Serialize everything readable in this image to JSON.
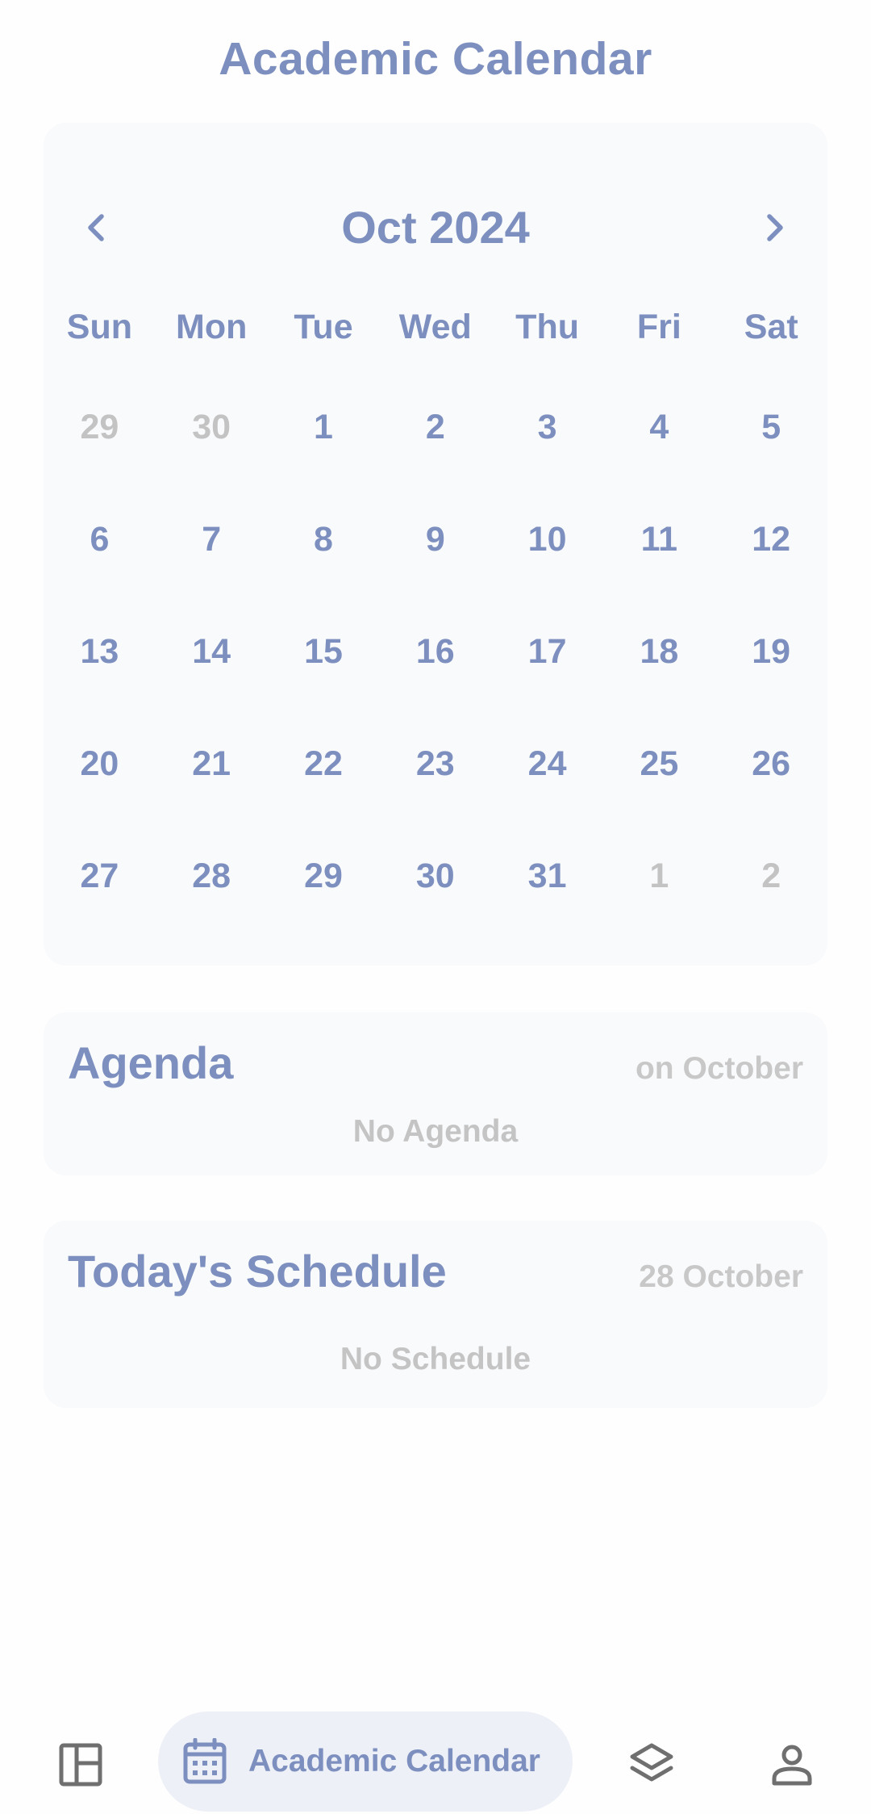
{
  "header": {
    "title": "Academic Calendar"
  },
  "calendar": {
    "month_label": "Oct 2024",
    "prev_icon": "chevron-left-icon",
    "next_icon": "chevron-right-icon",
    "weekdays": [
      "Sun",
      "Mon",
      "Tue",
      "Wed",
      "Thu",
      "Fri",
      "Sat"
    ],
    "days": [
      {
        "label": "29",
        "muted": true
      },
      {
        "label": "30",
        "muted": true
      },
      {
        "label": "1"
      },
      {
        "label": "2"
      },
      {
        "label": "3"
      },
      {
        "label": "4"
      },
      {
        "label": "5"
      },
      {
        "label": "6"
      },
      {
        "label": "7"
      },
      {
        "label": "8"
      },
      {
        "label": "9"
      },
      {
        "label": "10"
      },
      {
        "label": "11"
      },
      {
        "label": "12"
      },
      {
        "label": "13"
      },
      {
        "label": "14"
      },
      {
        "label": "15"
      },
      {
        "label": "16"
      },
      {
        "label": "17"
      },
      {
        "label": "18"
      },
      {
        "label": "19"
      },
      {
        "label": "20"
      },
      {
        "label": "21"
      },
      {
        "label": "22"
      },
      {
        "label": "23"
      },
      {
        "label": "24"
      },
      {
        "label": "25"
      },
      {
        "label": "26"
      },
      {
        "label": "27"
      },
      {
        "label": "28"
      },
      {
        "label": "29"
      },
      {
        "label": "30"
      },
      {
        "label": "31"
      },
      {
        "label": "1",
        "muted": true
      },
      {
        "label": "2",
        "muted": true
      }
    ]
  },
  "agenda": {
    "title": "Agenda",
    "meta": "on October",
    "empty": "No Agenda"
  },
  "schedule": {
    "title": "Today's Schedule",
    "meta": "28 October",
    "empty": "No Schedule"
  },
  "bottom_nav": {
    "items": [
      {
        "icon": "dashboard-icon"
      },
      {
        "icon": "calendar-icon",
        "label": "Academic Calendar",
        "active": true
      },
      {
        "icon": "layers-icon"
      },
      {
        "icon": "profile-icon"
      }
    ]
  },
  "colors": {
    "accent": "#7d8fbf",
    "muted": "#c3c3c3",
    "card": "#f9fafc",
    "nav_active_bg": "#eef0f7",
    "icon_gray": "#6f6f6f"
  }
}
